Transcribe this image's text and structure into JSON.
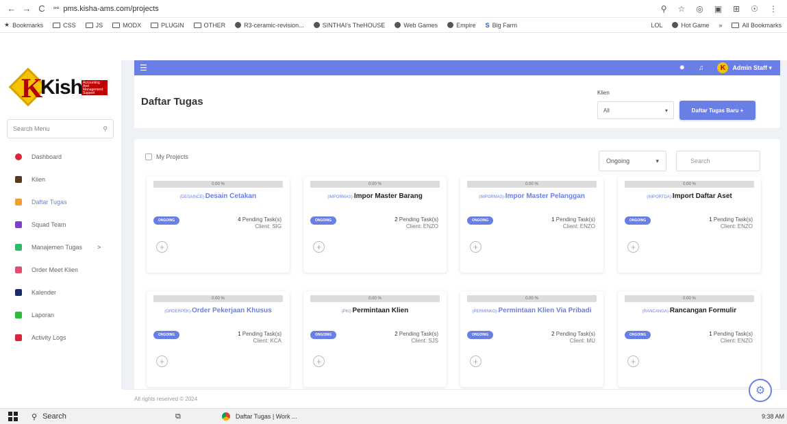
{
  "browser": {
    "url": "pms.kisha-ams.com/projects",
    "bookmarks": [
      "Bookmarks",
      "CSS",
      "JS",
      "MODX",
      "PLUGIN",
      "OTHER",
      "R3-ceramic-revision...",
      "SINTHAI's TheHOUSE",
      "Web Games",
      "Empire",
      "Big Farm"
    ],
    "bookmarks_right": [
      "LOL",
      "Hot Game",
      "»",
      "All Bookmarks"
    ]
  },
  "logo": {
    "word": "Kisha",
    "box_text": "Accounting And Management Support"
  },
  "sidebar": {
    "search_placeholder": "Search Menu",
    "items": [
      {
        "label": "Dashboard",
        "icon": "dashboard-icon",
        "color": "#d9263a"
      },
      {
        "label": "Klien",
        "icon": "user-icon",
        "color": "#5a3a1f"
      },
      {
        "label": "Daftar Tugas",
        "icon": "folder-icon",
        "color": "#f0a030",
        "active": true
      },
      {
        "label": "Squad Team",
        "icon": "team-icon",
        "color": "#7c3fc8"
      },
      {
        "label": "Manajemen Tugas",
        "icon": "list-icon",
        "color": "#2dbb6a",
        "chevron": ">"
      },
      {
        "label": "Order Meet Klien",
        "icon": "calendar-icon",
        "color": "#e05070"
      },
      {
        "label": "Kalender",
        "icon": "calendar-icon",
        "color": "#1a2a6b"
      },
      {
        "label": "Laporan",
        "icon": "report-icon",
        "color": "#2dbb3a"
      },
      {
        "label": "Activity Logs",
        "icon": "log-icon",
        "color": "#d9263a"
      }
    ]
  },
  "header": {
    "admin_initial": "K",
    "admin_name": "Admin Staff ▾"
  },
  "page": {
    "title": "Daftar Tugas",
    "klien_label": "Klien",
    "klien_value": "All",
    "new_button": "Daftar Tugas Baru +"
  },
  "filters": {
    "my_projects": "My Projects",
    "status": "Ongoing",
    "search_placeholder": "Search"
  },
  "tasks": [
    {
      "progress_pct": 0,
      "progress_label": "0.00 %",
      "code": "(DESAINCE)-",
      "name": "Desain Cetakan",
      "linked": true,
      "badge": "ONGOING",
      "pending_count": "4",
      "pending_text": "Pending Task(s)",
      "client": "Client: SIG"
    },
    {
      "progress_pct": 0,
      "progress_label": "0.00 %",
      "code": "(IMPORMAS)-",
      "name": "Impor Master Barang",
      "linked": false,
      "badge": "ONGOING",
      "pending_count": "2",
      "pending_text": "Pending Task(s)",
      "client": "Client: ENZO"
    },
    {
      "progress_pct": 0,
      "progress_label": "0.00 %",
      "code": "(IMPORMAS)-",
      "name": "Impor Master Pelanggan",
      "linked": true,
      "badge": "ONGOING",
      "pending_count": "1",
      "pending_text": "Pending Task(s)",
      "client": "Client: ENZO"
    },
    {
      "progress_pct": 0,
      "progress_label": "0.00 %",
      "code": "(IMPORTDA)-",
      "name": "Import Daftar Aset",
      "linked": false,
      "badge": "ONGOING",
      "pending_count": "1",
      "pending_text": "Pending Task(s)",
      "client": "Client: ENZO"
    },
    {
      "progress_pct": 0,
      "progress_label": "0.00 %",
      "code": "(ORDERPEK)-",
      "name": "Order Pekerjaan Khusus",
      "linked": true,
      "badge": "ONGOING",
      "pending_count": "1",
      "pending_text": "Pending Task(s)",
      "client": "Client: KCA"
    },
    {
      "progress_pct": 0,
      "progress_label": "0.00 %",
      "code": "(PKI)-",
      "name": "Permintaan Klien",
      "linked": false,
      "badge": "ONGOING",
      "pending_count": "2",
      "pending_text": "Pending Task(s)",
      "client": "Client: SJS"
    },
    {
      "progress_pct": 0,
      "progress_label": "0.00 %",
      "code": "(PERMINKO)-",
      "name": "Permintaan Klien Via Pribadi",
      "linked": true,
      "badge": "ONGOING",
      "pending_count": "2",
      "pending_text": "Pending Task(s)",
      "client": "Client: MU"
    },
    {
      "progress_pct": 0,
      "progress_label": "0.00 %",
      "code": "(RANCANGA)-",
      "name": "Rancangan Formulir",
      "linked": false,
      "badge": "ONGOING",
      "pending_count": "1",
      "pending_text": "Pending Task(s)",
      "client": "Client: ENZO"
    }
  ],
  "footer": {
    "text": "All rights reserved © 2024"
  },
  "taskbar": {
    "search": "Search",
    "app": "Daftar Tugas | Work ...",
    "clock": "9:38 AM"
  },
  "colors": {
    "accent": "#6a7fe6"
  }
}
